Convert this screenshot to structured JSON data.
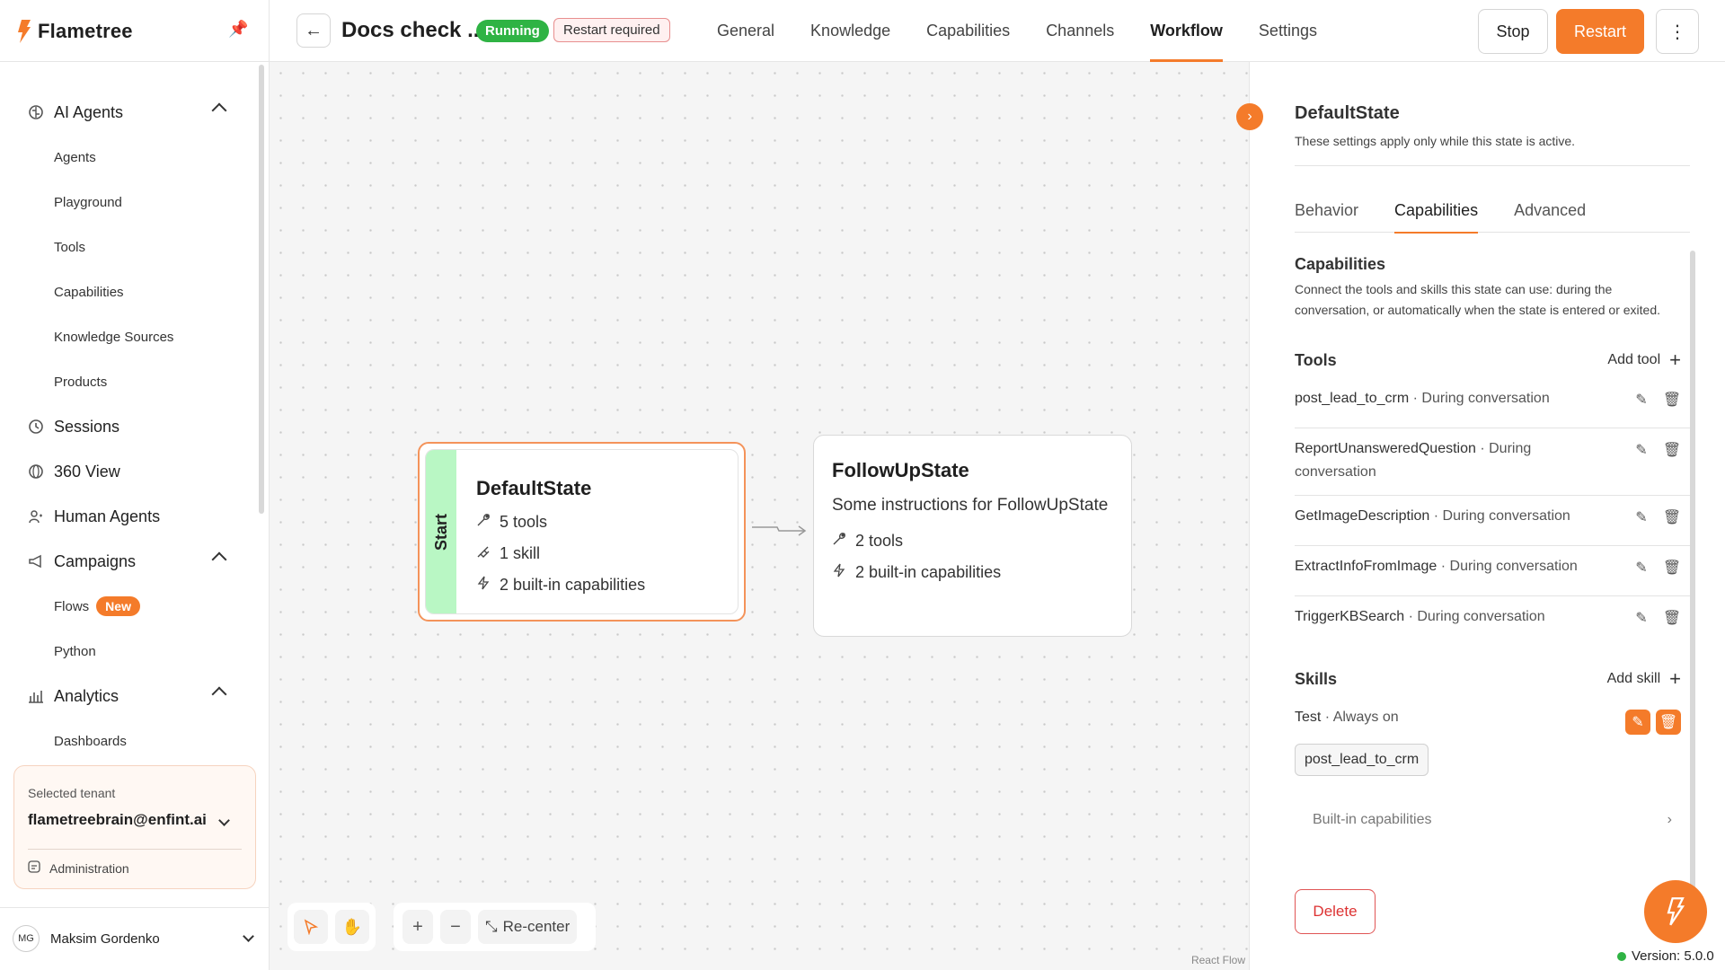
{
  "app": {
    "brand": "Flametree",
    "accent": "#f47b2a"
  },
  "sidebar": {
    "sections": [
      {
        "label": "AI Agents",
        "icon": "brain-icon",
        "expanded": true,
        "items": [
          "Agents",
          "Playground",
          "Tools",
          "Capabilities",
          "Knowledge Sources",
          "Products"
        ]
      },
      {
        "label": "Sessions",
        "icon": "history-icon"
      },
      {
        "label": "360 View",
        "icon": "view-360-icon"
      },
      {
        "label": "Human Agents",
        "icon": "people-icon"
      },
      {
        "label": "Campaigns",
        "icon": "megaphone-icon",
        "expanded": true,
        "items": [
          "Flows",
          "Python"
        ],
        "flows_badge": "New"
      },
      {
        "label": "Analytics",
        "icon": "bar-chart-icon",
        "expanded": true,
        "items": [
          "Dashboards"
        ]
      }
    ],
    "tenant": {
      "label": "Selected tenant",
      "value": "flametreebrain@enfint.ai",
      "admin": "Administration"
    },
    "user": {
      "initials": "MG",
      "name": "Maksim Gordenko"
    }
  },
  "header": {
    "title": "Docs check ...",
    "status": "Running",
    "status_color": "#2fb344",
    "restart_badge": "Restart required",
    "tabs": [
      "General",
      "Knowledge",
      "Capabilities",
      "Channels",
      "Workflow",
      "Settings"
    ],
    "active_tab": "Workflow",
    "stop": "Stop",
    "restart": "Restart",
    "more": "⋮"
  },
  "canvas": {
    "default_node": {
      "start": "Start",
      "title": "DefaultState",
      "tools": "5 tools",
      "skills": "1 skill",
      "builtin": "2 built-in capabilities"
    },
    "follow_node": {
      "title": "FollowUpState",
      "desc": "Some instructions for FollowUpState",
      "tools": "2 tools",
      "builtin": "2 built-in capabilities"
    },
    "recenter": "Re-center",
    "attribution": "React Flow"
  },
  "panel": {
    "title": "DefaultState",
    "subtitle": "These settings apply only while this state is active.",
    "tabs": [
      "Behavior",
      "Capabilities",
      "Advanced"
    ],
    "active_tab": "Capabilities",
    "cap_title": "Capabilities",
    "cap_desc": "Connect the tools and skills this state can use: during the conversation, or automatically when the state is entered or exited.",
    "tools_title": "Tools",
    "add_tool": "Add tool",
    "tools": [
      {
        "name": "post_lead_to_crm",
        "mode": "· During conversation"
      },
      {
        "name": "ReportUnansweredQuestion",
        "mode": "· During conversation"
      },
      {
        "name": "GetImageDescription",
        "mode": "· During conversation"
      },
      {
        "name": "ExtractInfoFromImage",
        "mode": "· During conversation"
      },
      {
        "name": "TriggerKBSearch",
        "mode": "· During conversation"
      }
    ],
    "skills_title": "Skills",
    "add_skill": "Add skill",
    "skill": {
      "name": "Test",
      "mode": "· Always on",
      "chip": "post_lead_to_crm"
    },
    "builtin": "Built-in capabilities",
    "delete": "Delete",
    "version": "Version: 5.0.0"
  }
}
